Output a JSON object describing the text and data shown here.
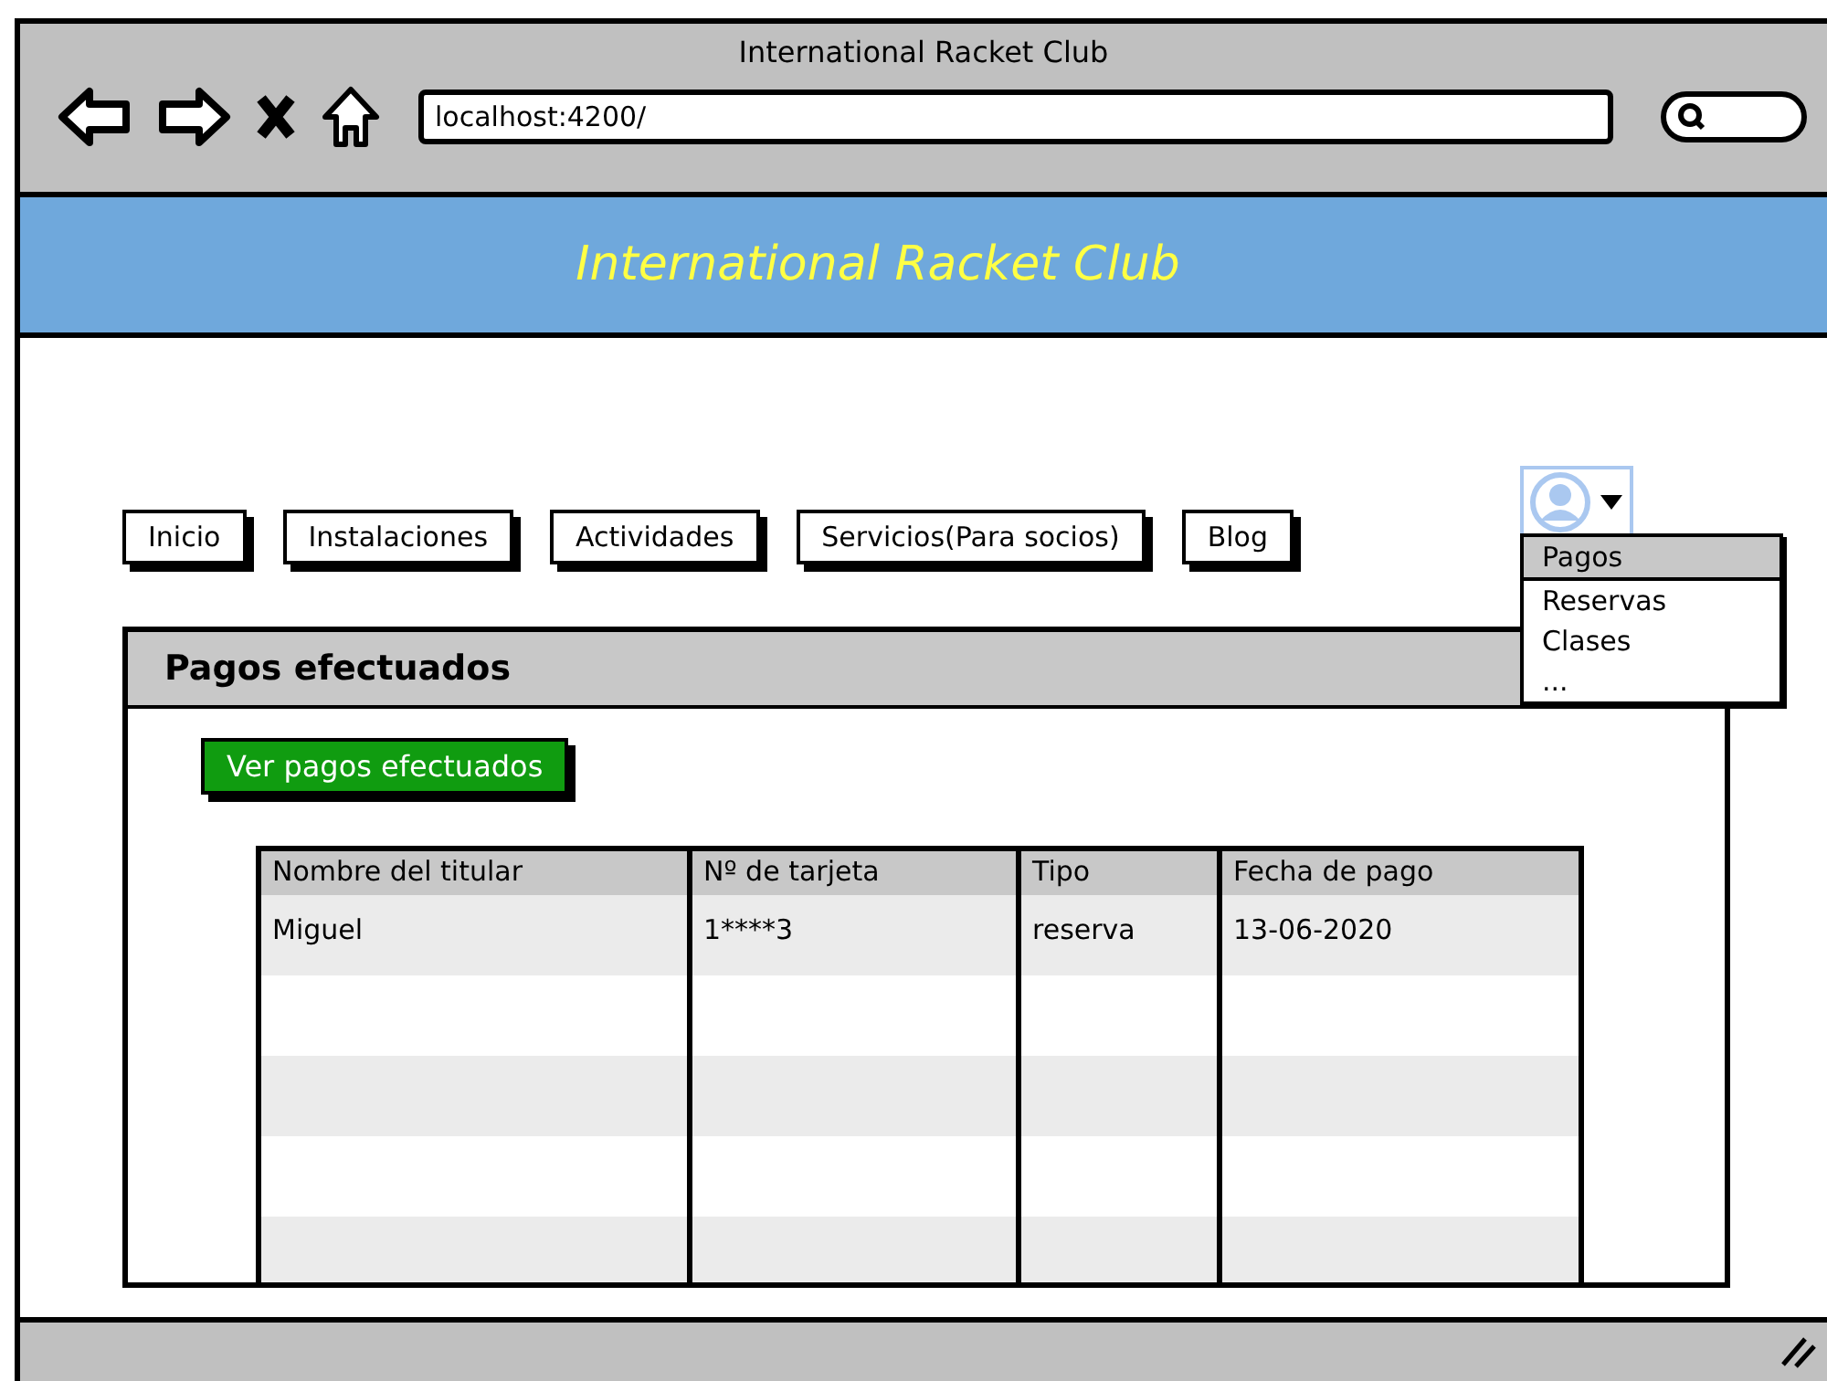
{
  "window": {
    "title": "International Racket Club"
  },
  "browser": {
    "url": "localhost:4200/"
  },
  "banner": {
    "title": "International Racket Club"
  },
  "nav": [
    {
      "label": "Inicio"
    },
    {
      "label": "Instalaciones"
    },
    {
      "label": "Actividades"
    },
    {
      "label": "Servicios(Para socios)"
    },
    {
      "label": "Blog"
    }
  ],
  "user_menu": {
    "expanded": true,
    "items": [
      {
        "label": "Pagos",
        "selected": true
      },
      {
        "label": "Reservas",
        "selected": false
      },
      {
        "label": "Clases",
        "selected": false
      },
      {
        "label": "...",
        "selected": false
      }
    ]
  },
  "panel": {
    "title": "Pagos efectuados",
    "button": "Ver pagos efectuados",
    "table": {
      "columns": [
        "Nombre del titular",
        "Nº de tarjeta",
        "Tipo",
        "Fecha de pago"
      ],
      "rows": [
        [
          "Miguel",
          "1****3",
          "reserva",
          "13-06-2020"
        ]
      ]
    }
  }
}
